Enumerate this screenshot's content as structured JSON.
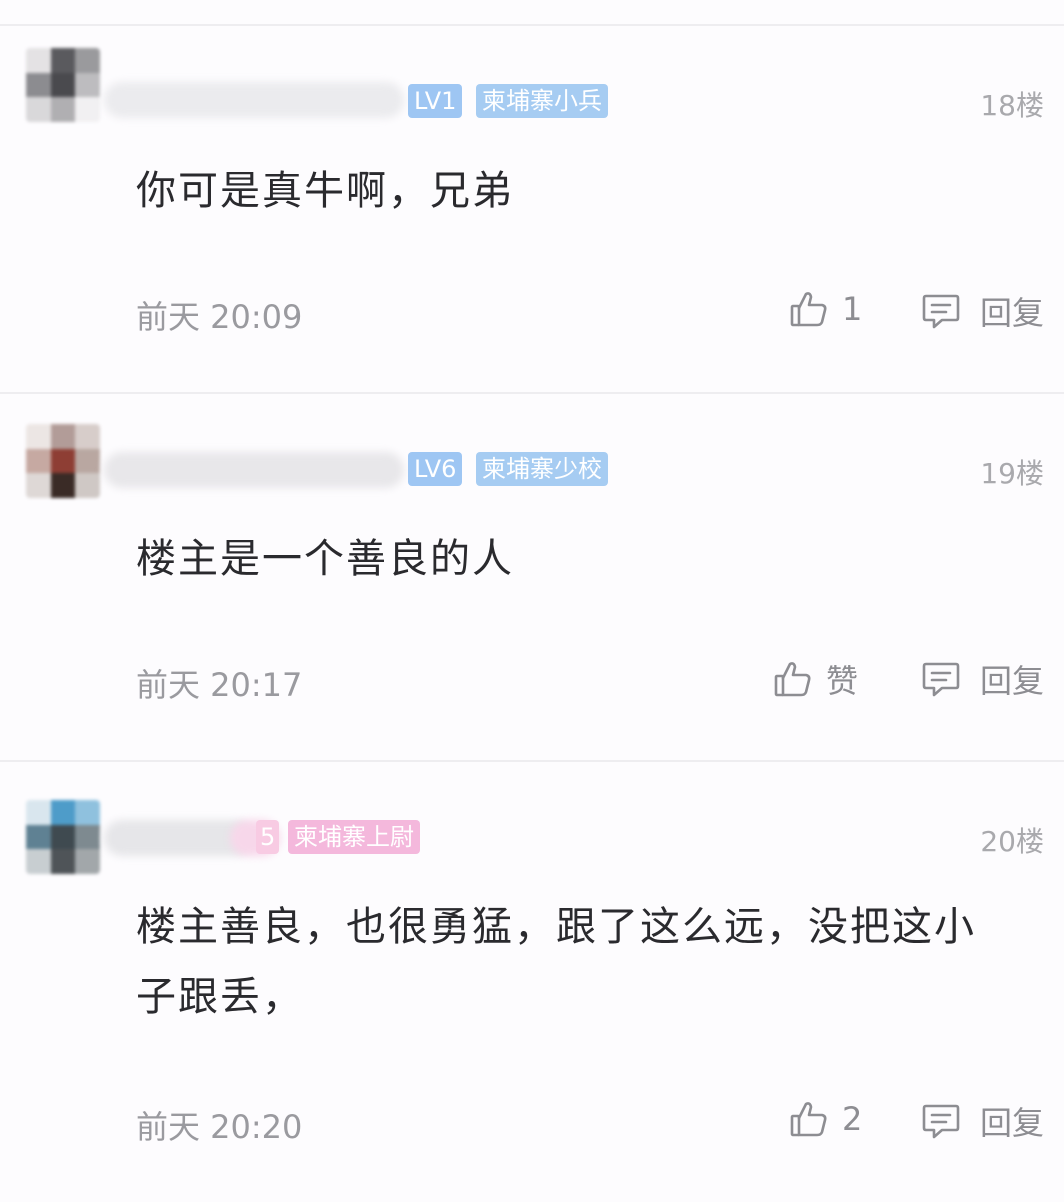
{
  "comments": [
    {
      "level": "LV1",
      "rank": "柬埔寨小兵",
      "floor": "18楼",
      "text": "你可是真牛啊，兄弟",
      "time": "前天 20:09",
      "likes": "1",
      "reply_label": "回复"
    },
    {
      "level": "LV6",
      "rank": "柬埔寨少校",
      "floor": "19楼",
      "text": "楼主是一个善良的人",
      "time": "前天 20:17",
      "likes": "赞",
      "reply_label": "回复"
    },
    {
      "level": "5",
      "rank": "柬埔寨上尉",
      "floor": "20楼",
      "text": "楼主善良，也很勇猛，跟了这么远，没把这小子跟丢，",
      "time": "前天 20:20",
      "likes": "2",
      "reply_label": "回复"
    }
  ],
  "icons": {
    "like": "thumbs-up-icon",
    "reply": "comment-bubble-icon"
  },
  "colors": {
    "badge_blue": "#9ec6f3",
    "badge_pink": "#f4b8dc",
    "text": "#2a2a2e",
    "muted": "#9a9a9f"
  }
}
